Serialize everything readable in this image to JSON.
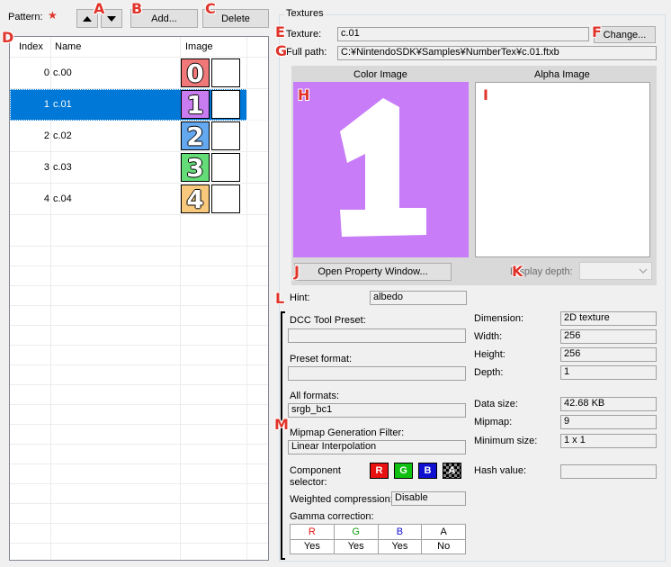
{
  "pattern": {
    "label": "Pattern:",
    "required_mark": "★",
    "add_label": "Add...",
    "delete_label": "Delete"
  },
  "list": {
    "headers": [
      "Index",
      "Name",
      "Image"
    ],
    "rows": [
      {
        "index": "0",
        "name": "c.00",
        "glyph": "0",
        "color": "#f07878"
      },
      {
        "index": "1",
        "name": "c.01",
        "glyph": "1",
        "color": "#c87cf0"
      },
      {
        "index": "2",
        "name": "c.02",
        "glyph": "2",
        "color": "#64a8f0"
      },
      {
        "index": "3",
        "name": "c.03",
        "glyph": "3",
        "color": "#64dc78"
      },
      {
        "index": "4",
        "name": "c.04",
        "glyph": "4",
        "color": "#f8c87c"
      }
    ],
    "selected_index": 1
  },
  "textures": {
    "group_title": "Textures",
    "texture_label": "Texture:",
    "texture_value": "c.01",
    "change_label": "Change...",
    "fullpath_label": "Full path:",
    "fullpath_value": "C:¥NintendoSDK¥Samples¥NumberTex¥c.01.ftxb",
    "color_image_label": "Color Image",
    "alpha_image_label": "Alpha Image",
    "preview_glyph": "1",
    "preview_color": "#c87cf8",
    "open_property_label": "Open Property Window...",
    "display_depth_label": "Display depth:"
  },
  "hint": {
    "label": "Hint:",
    "value": "albedo"
  },
  "left_props": {
    "dcc_preset_label": "DCC Tool Preset:",
    "dcc_preset_value": "",
    "preset_format_label": "Preset format:",
    "preset_format_value": "",
    "all_formats_label": "All formats:",
    "all_formats_value": "srgb_bc1",
    "mipmap_filter_label": "Mipmap Generation Filter:",
    "mipmap_filter_value": "Linear Interpolation",
    "component_label_1": "Component",
    "component_label_2": "selector:",
    "components": [
      "R",
      "G",
      "B",
      "A"
    ],
    "weighted_label": "Weighted compression:",
    "weighted_value": "Disable",
    "gamma_label": "Gamma correction:",
    "gamma_headers": [
      "R",
      "G",
      "B",
      "A"
    ],
    "gamma_values": [
      "Yes",
      "Yes",
      "Yes",
      "No"
    ]
  },
  "right_props": {
    "dimension_label": "Dimension:",
    "dimension_value": "2D texture",
    "width_label": "Width:",
    "width_value": "256",
    "height_label": "Height:",
    "height_value": "256",
    "depth_label": "Depth:",
    "depth_value": "1",
    "datasize_label": "Data size:",
    "datasize_value": "42.68 KB",
    "mipmap_label": "Mipmap:",
    "mipmap_value": "9",
    "minsize_label": "Minimum size:",
    "minsize_value": "1 x 1",
    "hash_label": "Hash value:",
    "hash_value": ""
  },
  "markers": [
    "A",
    "B",
    "C",
    "D",
    "E",
    "F",
    "G",
    "H",
    "I",
    "J",
    "K",
    "L",
    "M"
  ],
  "colors": {
    "selection": "#0078d7",
    "marker": "#e0342a"
  }
}
